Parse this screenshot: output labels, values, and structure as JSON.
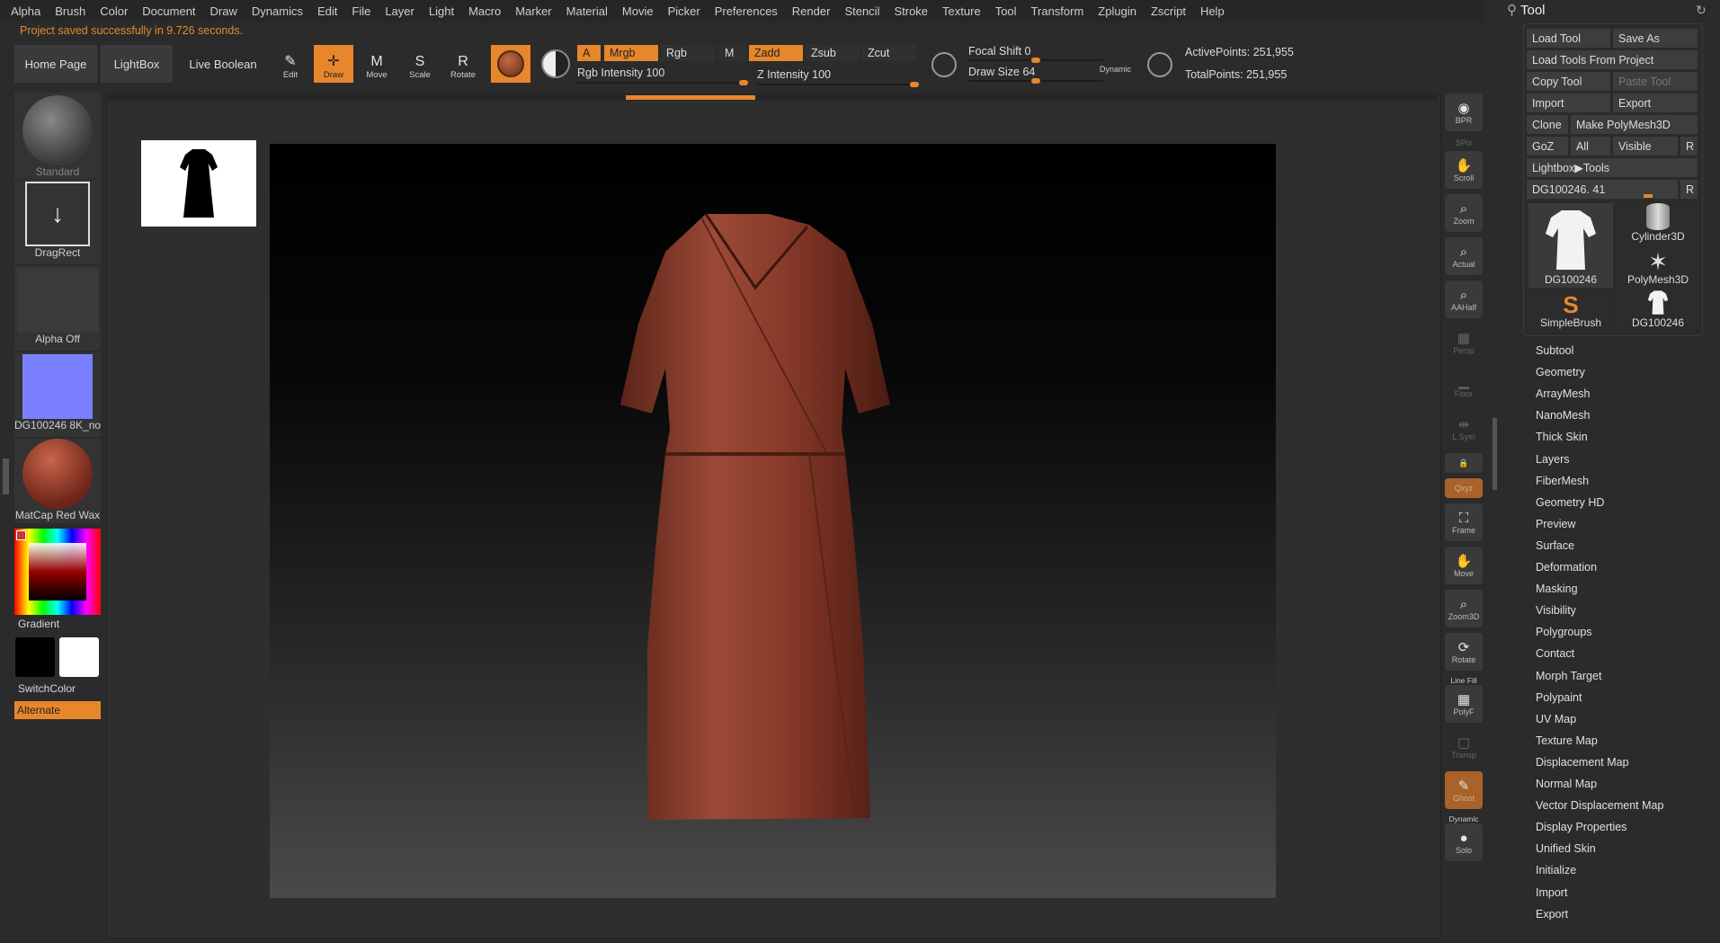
{
  "menu": [
    "Alpha",
    "Brush",
    "Color",
    "Document",
    "Draw",
    "Dynamics",
    "Edit",
    "File",
    "Layer",
    "Light",
    "Macro",
    "Marker",
    "Material",
    "Movie",
    "Picker",
    "Preferences",
    "Render",
    "Stencil",
    "Stroke",
    "Texture",
    "Tool",
    "Transform",
    "Zplugin",
    "Zscript",
    "Help"
  ],
  "status_message": "Project saved successfully in 9.726 seconds.",
  "top_buttons": {
    "home": "Home Page",
    "lightbox": "LightBox",
    "live_boolean": "Live Boolean"
  },
  "transform_buttons": [
    {
      "label": "Edit",
      "icon": "edit-icon"
    },
    {
      "label": "Draw",
      "icon": "draw-icon",
      "active": true
    },
    {
      "label": "Move",
      "icon": "move-icon"
    },
    {
      "label": "Scale",
      "icon": "scale-icon"
    },
    {
      "label": "Rotate",
      "icon": "rotate-icon"
    }
  ],
  "modes": {
    "a": "A",
    "mrgb": "Mrgb",
    "rgb": "Rgb",
    "m": "M",
    "zadd": "Zadd",
    "zsub": "Zsub",
    "zcut": "Zcut"
  },
  "sliders": {
    "rgb_intensity": {
      "label": "Rgb Intensity",
      "value": "100",
      "fraction": 1.0
    },
    "z_intensity": {
      "label": "Z Intensity",
      "value": "100",
      "fraction": 1.0
    },
    "focal_shift": {
      "label": "Focal Shift",
      "value": "0",
      "fraction": 0.5
    },
    "draw_size": {
      "label": "Draw Size",
      "value": "64",
      "fraction": 0.5
    },
    "dynamic": "Dynamic"
  },
  "points": {
    "active": "ActivePoints: 251,955",
    "total": "TotalPoints: 251,955"
  },
  "left_shelf": {
    "brush": "Standard",
    "stroke": "DragRect",
    "alpha": "Alpha Off",
    "texture": "DG100246 8K_no",
    "material": "MatCap Red Wax",
    "gradient": "Gradient",
    "switch_color": "SwitchColor",
    "alternate": "Alternate"
  },
  "right_toolbar": [
    {
      "label": "BPR",
      "icon": "bpr-icon",
      "dim": false
    },
    {
      "label": "SPix",
      "icon": "",
      "dim": true
    },
    {
      "label": "Scroll",
      "icon": "scroll-icon",
      "dim": false
    },
    {
      "label": "Zoom",
      "icon": "zoom-icon",
      "dim": false
    },
    {
      "label": "Actual",
      "icon": "actual-icon",
      "dim": false
    },
    {
      "label": "AAHalf",
      "icon": "aahalf-icon",
      "dim": false
    },
    {
      "label": "Persp",
      "icon": "persp-icon",
      "dim": true
    },
    {
      "label": "Floor",
      "icon": "floor-icon",
      "dim": true
    },
    {
      "label": "L.Sym",
      "icon": "lsym-icon",
      "dim": true
    },
    {
      "label": "",
      "icon": "lock-icon",
      "dim": false
    },
    {
      "label": "Qxyz",
      "icon": "",
      "orange": true
    },
    {
      "label": "Frame",
      "icon": "frame-icon",
      "dim": false
    },
    {
      "label": "Move",
      "icon": "move-icon",
      "dim": false
    },
    {
      "label": "Zoom3D",
      "icon": "zoom3d-icon",
      "dim": false
    },
    {
      "label": "Rotate",
      "icon": "rotate-icon",
      "dim": false
    },
    {
      "label": "PolyF",
      "icon": "polyf-icon",
      "dim": false,
      "top": "Line Fill"
    },
    {
      "label": "Transp",
      "icon": "transp-icon",
      "dim": true
    },
    {
      "label": "Ghost",
      "icon": "ghost-icon",
      "orange": true
    },
    {
      "label": "Solo",
      "icon": "solo-icon",
      "dim": false,
      "top": "Dynamic"
    }
  ],
  "tool_panel": {
    "title": "Tool",
    "load_tool": "Load Tool",
    "save_as": "Save As",
    "load_from_project": "Load Tools From Project",
    "copy_tool": "Copy Tool",
    "paste_tool": "Paste Tool",
    "import": "Import",
    "export": "Export",
    "clone": "Clone",
    "make_polymesh": "Make PolyMesh3D",
    "goz": "GoZ",
    "all": "All",
    "visible": "Visible",
    "r": "R",
    "lightbox_tools": "Lightbox▶Tools",
    "current_tool": "DG100246. 41",
    "r2": "R",
    "tools": [
      "DG100246",
      "Cylinder3D",
      "PolyMesh3D",
      "SimpleBrush",
      "DG100246"
    ],
    "subpalettes": [
      "Subtool",
      "Geometry",
      "ArrayMesh",
      "NanoMesh",
      "Thick Skin",
      "Layers",
      "FiberMesh",
      "Geometry HD",
      "Preview",
      "Surface",
      "Deformation",
      "Masking",
      "Visibility",
      "Polygroups",
      "Contact",
      "Morph Target",
      "Polypaint",
      "UV Map",
      "Texture Map",
      "Displacement Map",
      "Normal Map",
      "Vector Displacement Map",
      "Display Properties",
      "Unified Skin",
      "Initialize",
      "Import",
      "Export"
    ]
  },
  "colors": {
    "accent": "#e8862c",
    "dress": "#8a3a2a"
  }
}
